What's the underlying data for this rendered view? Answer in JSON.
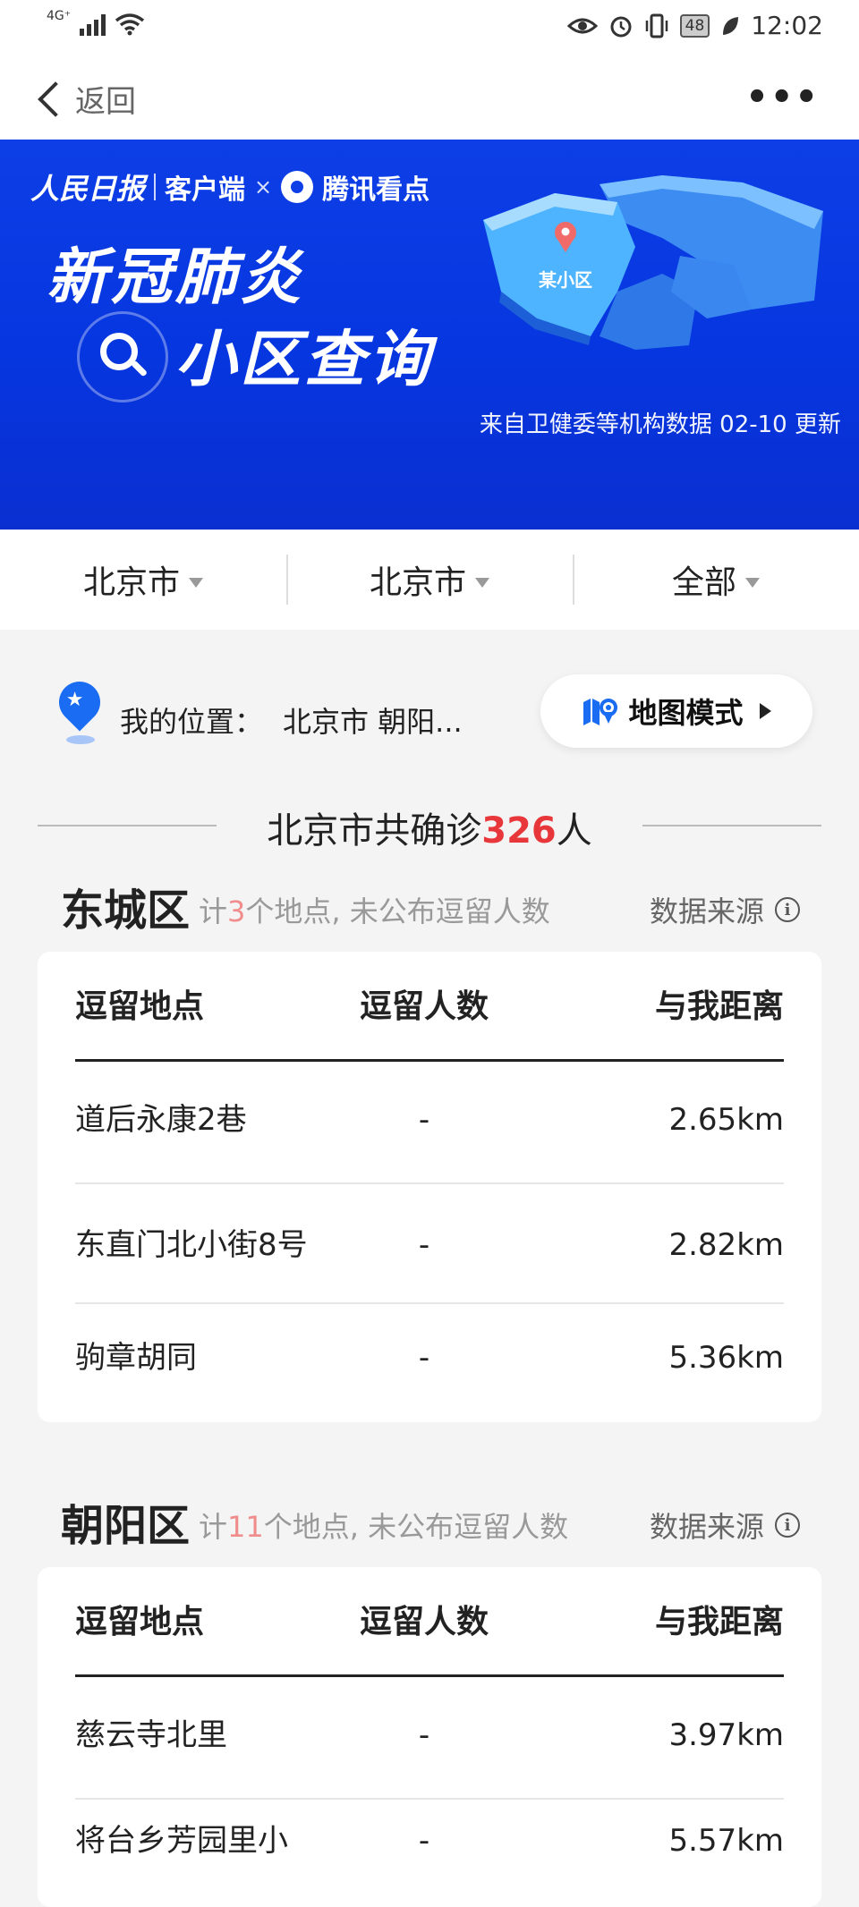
{
  "status_bar": {
    "network": "4G⁺",
    "battery": "48",
    "time": "12:02"
  },
  "nav": {
    "back_label": "返回"
  },
  "banner": {
    "brand_left": "人民日报",
    "brand_left_suffix": "客户端",
    "brand_x": "×",
    "brand_right": "腾讯看点",
    "title_line1": "新冠肺炎",
    "title_line2": "小区查询",
    "map_marker_label": "某小区",
    "update_note": "来自卫健委等机构数据 02-10 更新"
  },
  "filters": [
    {
      "label": "北京市"
    },
    {
      "label": "北京市"
    },
    {
      "label": "全部"
    }
  ],
  "location": {
    "label": "我的位置：",
    "value": "北京市 朝阳...",
    "map_mode_label": "地图模式"
  },
  "total": {
    "prefix": "北京市共确诊",
    "count": "326",
    "suffix": "人"
  },
  "districts": [
    {
      "name": "东城区",
      "count_prefix": "计",
      "count": "3",
      "count_suffix": "个地点, 未公布逗留人数",
      "source_label": "数据来源",
      "columns": [
        "逗留地点",
        "逗留人数",
        "与我距离"
      ],
      "rows": [
        {
          "place": "道后永康2巷",
          "people": "-",
          "distance": "2.65km"
        },
        {
          "place": "东直门北小街8号",
          "people": "-",
          "distance": "2.82km"
        },
        {
          "place": "驹章胡同",
          "people": "-",
          "distance": "5.36km"
        }
      ]
    },
    {
      "name": "朝阳区",
      "count_prefix": "计",
      "count": "11",
      "count_suffix": "个地点, 未公布逗留人数",
      "source_label": "数据来源",
      "columns": [
        "逗留地点",
        "逗留人数",
        "与我距离"
      ],
      "rows": [
        {
          "place": "慈云寺北里",
          "people": "-",
          "distance": "3.97km"
        },
        {
          "place": "将台乡芳园里小",
          "people": "-",
          "distance": "5.57km"
        }
      ]
    }
  ],
  "colors": {
    "banner_blue": "#0a3be3",
    "accent_red": "#e8373a",
    "pin_blue": "#1a6cf3"
  }
}
